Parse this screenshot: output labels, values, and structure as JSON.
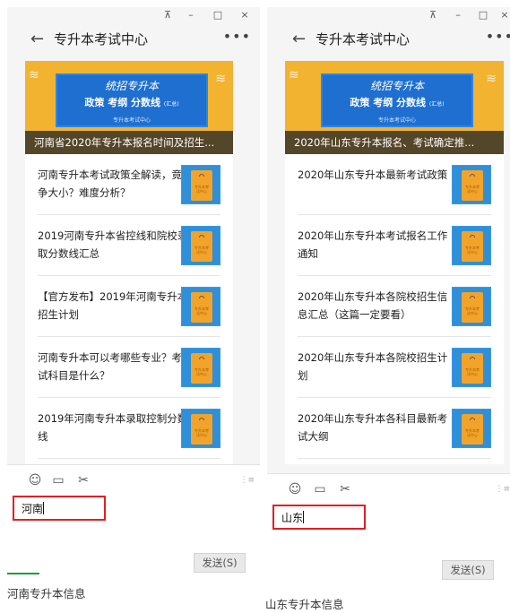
{
  "icons": {
    "pin": "pin-icon",
    "minimize": "minimize-icon",
    "maximize": "maximize-icon",
    "close": "close-icon",
    "back": "back-arrow-icon",
    "more": "more-icon",
    "emoji": "emoji-icon",
    "folder": "folder-icon",
    "scissors": "scissors-icon",
    "collapse": "collapse-icon"
  },
  "colors": {
    "highlight_border": "#e02020",
    "banner_bg": "#f2b330",
    "board_blue": "#1e6fd0"
  },
  "left": {
    "title": "专升本考试中心",
    "banner": {
      "line1": "统招专升本",
      "line2": "政策  考纲  分数线",
      "line2_note": "(汇总)",
      "line3": "专升本考试中心",
      "caption": "河南省2020年专升本报名时间及招生..."
    },
    "articles": [
      {
        "title": "河南专升本考试政策全解读，竟争大小？难度分析？"
      },
      {
        "title": "2019河南专升本省控线和院校录取分数线汇总"
      },
      {
        "title": "【官方发布】2019年河南专升本招生计划"
      },
      {
        "title": "河南专升本可以考哪些专业？考试科目是什么？"
      },
      {
        "title": "2019年河南专升本录取控制分数线"
      }
    ],
    "input_value": "河南",
    "send_label": "发送(S)",
    "caption": "河南专升本信息"
  },
  "right": {
    "title": "专升本考试中心",
    "banner": {
      "line1": "统招专升本",
      "line2": "政策  考纲  分数线",
      "line2_note": "(汇总)",
      "line3": "专升本考试中心",
      "caption": "2020年山东专升本报名、考试确定推..."
    },
    "articles": [
      {
        "title": "2020年山东专升本最新考试政策"
      },
      {
        "title": "2020年山东专升本考试报名工作通知"
      },
      {
        "title": "2020年山东专升本各院校招生信息汇总（这篇一定要看）"
      },
      {
        "title": "2020年山东专升本各院校招生计划"
      },
      {
        "title": "2020年山东专升本各科目最新考试大纲"
      }
    ],
    "input_value": "山东",
    "send_label": "发送(S)",
    "caption": "山东专升本信息"
  }
}
